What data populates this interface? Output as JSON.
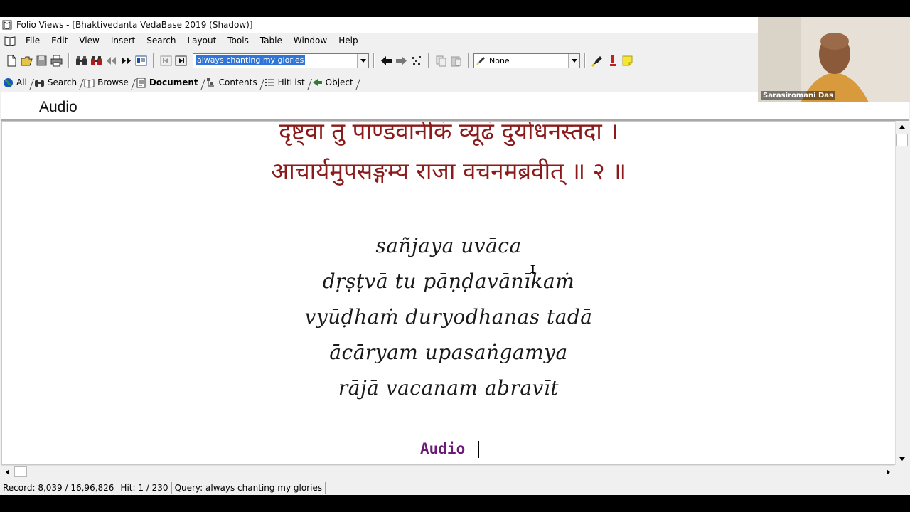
{
  "window": {
    "title": "Folio Views - [Bhaktivedanta VedaBase 2019 (Shadow)]"
  },
  "menubar": {
    "items": [
      "File",
      "Edit",
      "View",
      "Insert",
      "Search",
      "Layout",
      "Tools",
      "Table",
      "Window",
      "Help"
    ]
  },
  "toolbar": {
    "query_value": "always chanting my glories",
    "style_value": "None"
  },
  "viewtabs": {
    "items": [
      "All",
      "Search",
      "Browse",
      "Document",
      "Contents",
      "HitList",
      "Object"
    ],
    "active": "Document"
  },
  "header": {
    "title": "Audio"
  },
  "document": {
    "devanagari": [
      "दृष्ट्वा तु पाण्डवानीकं व्यूढं दुर्योधनस्तदा ।",
      "आचार्यमुपसङ्गम्य राजा वचनमब्रवीत् ॥ २ ॥"
    ],
    "verse": [
      "sañjaya uvāca",
      "dṛṣṭvā tu pāṇḍavānīkaṁ",
      "vyūḍhaṁ duryodhanas tadā",
      "ācāryam upasaṅgamya",
      "rājā vacanam abravīt"
    ],
    "audio_link": "Audio"
  },
  "statusbar": {
    "record": "Record: 8,039 / 16,96,826",
    "hit": "Hit: 1 / 230",
    "query": "Query: always chanting my glories"
  },
  "webcam": {
    "name": "Sarasiromani Das"
  },
  "colors": {
    "devanagari": "#8b1a1a",
    "audio_link": "#6b1a78",
    "selection": "#3175d6"
  }
}
